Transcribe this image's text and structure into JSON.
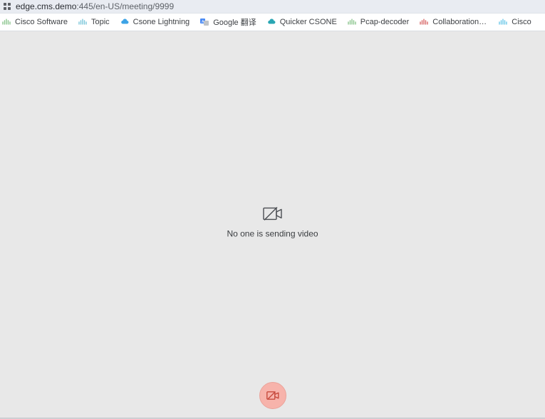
{
  "address": {
    "host": "edge.cms.demo",
    "port_path": ":445/en-US/meeting/9999"
  },
  "bookmarks": [
    {
      "label": "Cisco Software",
      "icon": "bridge-green"
    },
    {
      "label": "Topic",
      "icon": "bridge-lblue"
    },
    {
      "label": "Csone Lightning",
      "icon": "cloud-blue"
    },
    {
      "label": "Google 翻译",
      "icon": "translate"
    },
    {
      "label": "Quicker CSONE",
      "icon": "cloud-teal"
    },
    {
      "label": "Pcap-decoder",
      "icon": "bridge-green2"
    },
    {
      "label": "Collaboration Solu…",
      "icon": "bridge-red"
    },
    {
      "label": "Cisco",
      "icon": "bridge-sky"
    }
  ],
  "video": {
    "status": "No one is sending video"
  }
}
